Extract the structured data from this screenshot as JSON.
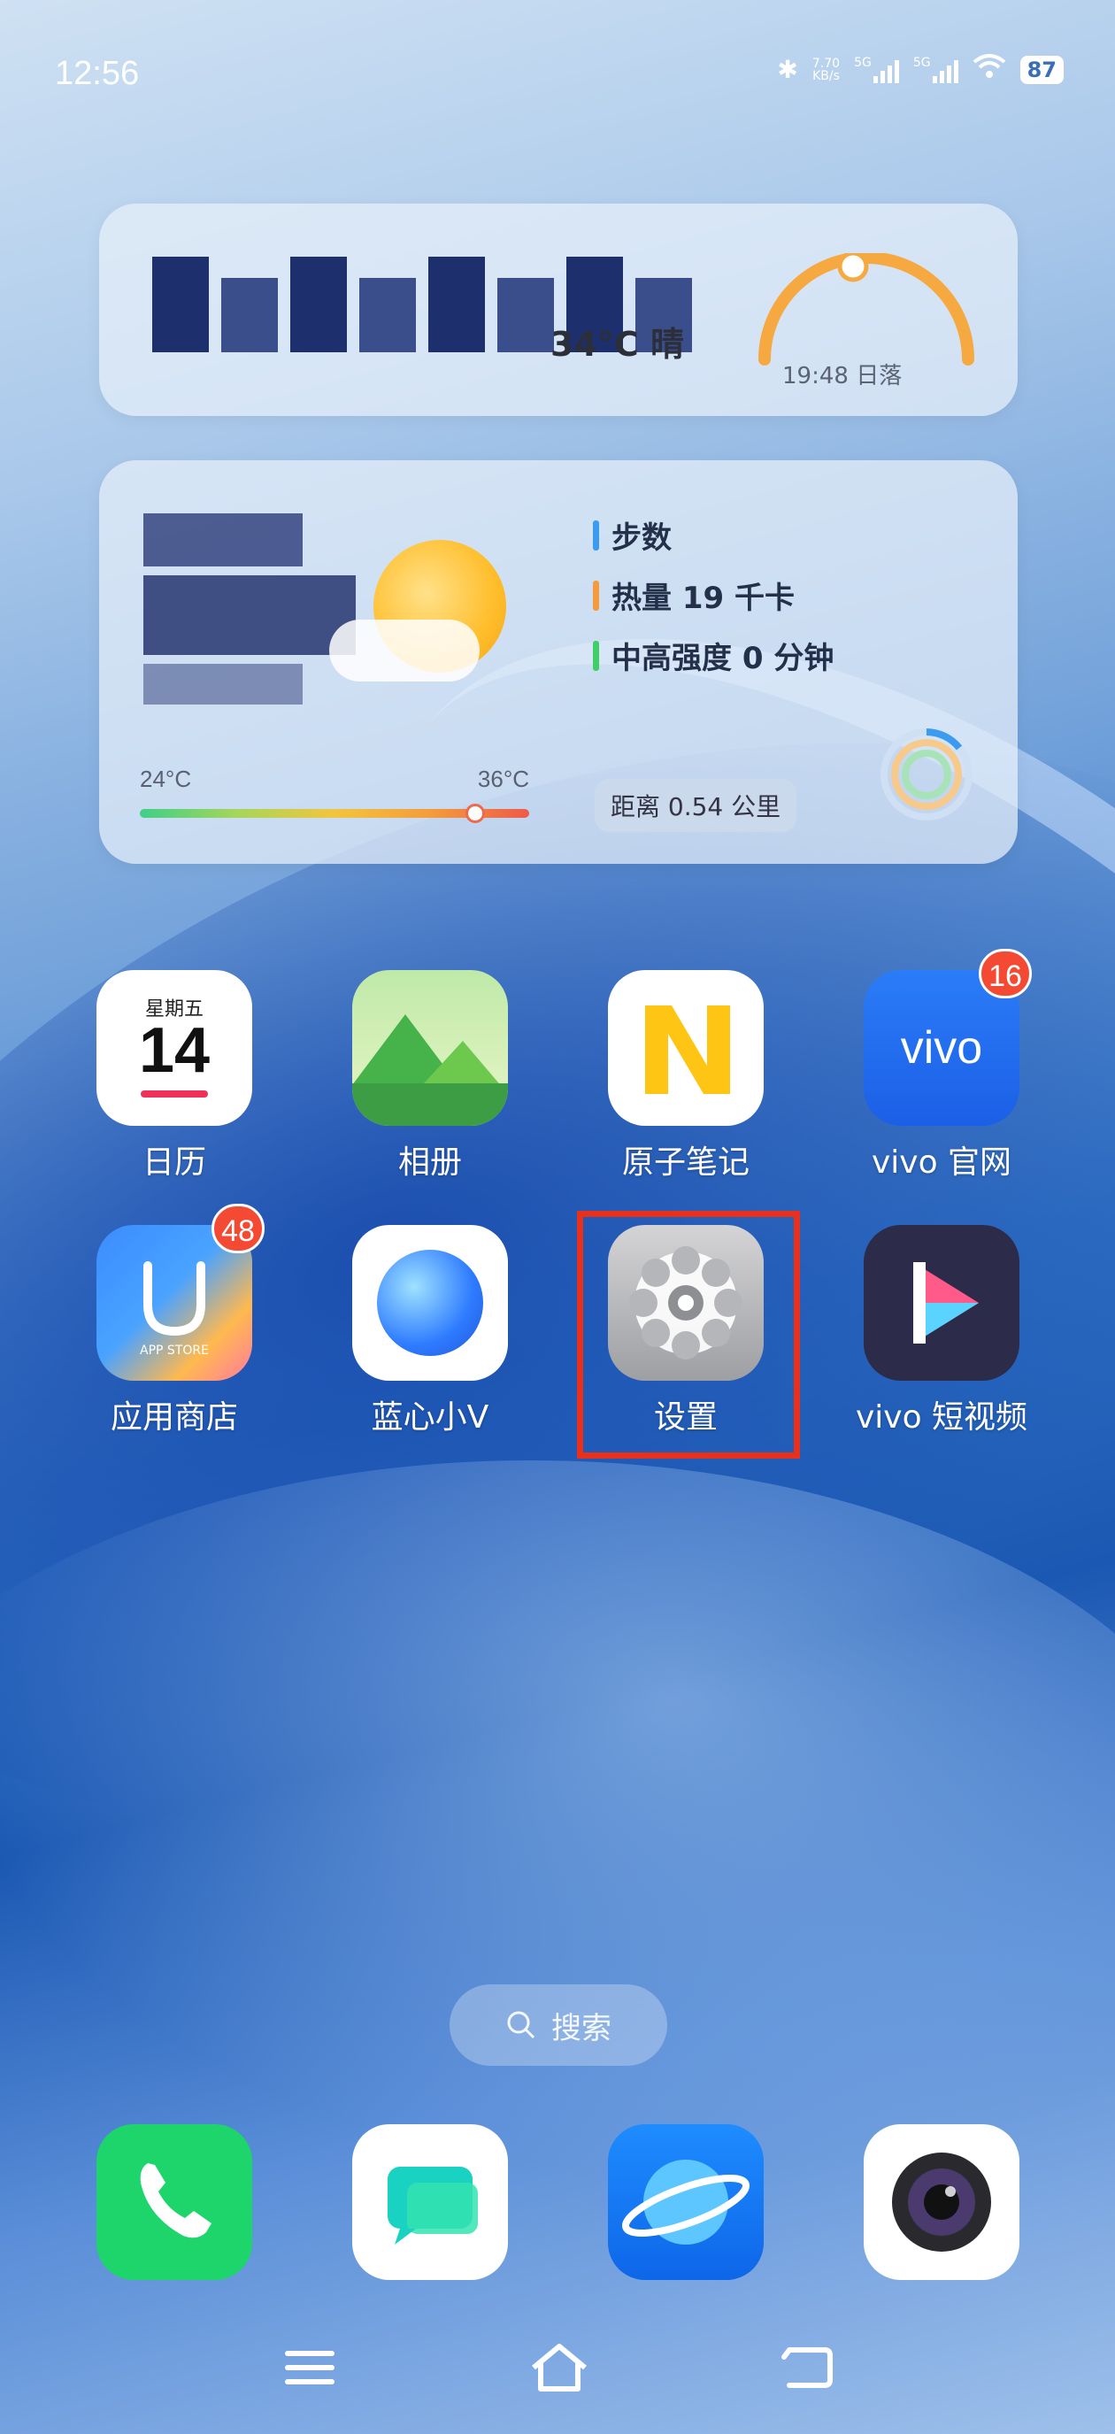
{
  "status_bar": {
    "time": "12:56",
    "net_speed_top": "7.70",
    "net_speed_bottom": "KB/s",
    "signal1": "5G",
    "signal2": "5G",
    "battery": "87"
  },
  "time_widget": {
    "temperature": "34°C 晴",
    "sunset": "19:48 日落"
  },
  "weather_widget": {
    "low": "24°C",
    "high": "36°C"
  },
  "health_widget": {
    "steps_label": "步数",
    "calories_label": "热量 19 千卡",
    "activity_label": "中高强度 0 分钟",
    "distance": "距离 0.54 公里"
  },
  "calendar_icon": {
    "weekday": "星期五",
    "day": "14"
  },
  "apps": [
    {
      "label": "日历"
    },
    {
      "label": "相册"
    },
    {
      "label": "原子笔记"
    },
    {
      "label": "vivo 官网",
      "badge": "16",
      "logo": "vivo"
    },
    {
      "label": "应用商店",
      "badge": "48",
      "subtext": "APP STORE"
    },
    {
      "label": "蓝心小V"
    },
    {
      "label": "设置"
    },
    {
      "label": "vivo 短视频"
    }
  ],
  "search": {
    "label": "搜索"
  },
  "dock": [
    "phone-icon",
    "messages-icon",
    "browser-icon",
    "camera-icon"
  ],
  "colors": {
    "highlight": "#e8301b",
    "badge": "#f44a34",
    "phone": "#1dd56a"
  }
}
